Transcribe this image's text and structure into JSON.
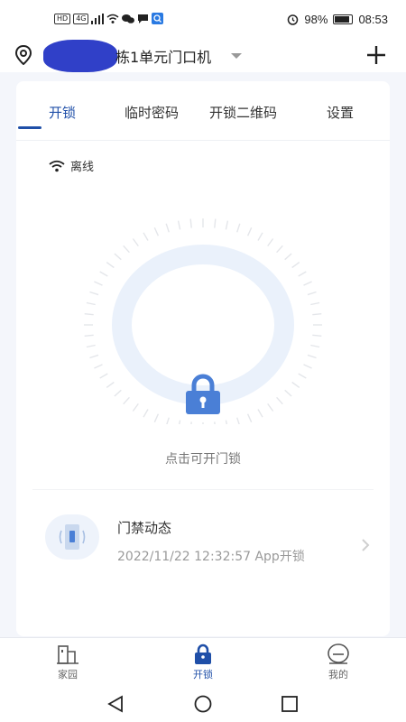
{
  "status_bar": {
    "left_chips": [
      "HD",
      "4G"
    ],
    "battery": "98%",
    "time": "08:53"
  },
  "header": {
    "title": "栋1单元门口机"
  },
  "tabs": [
    {
      "label": "开锁"
    },
    {
      "label": "临时密码"
    },
    {
      "label": "开锁二维码"
    },
    {
      "label": "设置"
    }
  ],
  "device": {
    "status": "离线"
  },
  "unlock": {
    "hint": "点击可开门锁"
  },
  "activity": {
    "title": "门禁动态",
    "subtitle": "2022/11/22 12:32:57 App开锁"
  },
  "bottom_nav": [
    {
      "label": "家园"
    },
    {
      "label": "开锁"
    },
    {
      "label": "我的"
    }
  ],
  "colors": {
    "accent": "#1f4fa8",
    "lock": "#4a7fd6"
  }
}
